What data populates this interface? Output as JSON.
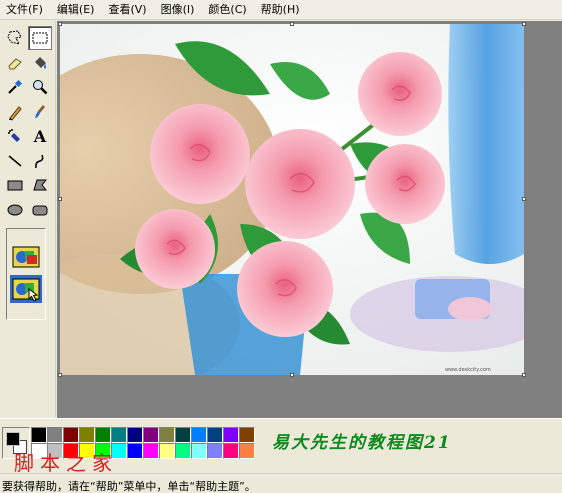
{
  "menu": [
    {
      "label": "文件(F)"
    },
    {
      "label": "编辑(E)"
    },
    {
      "label": "查看(V)"
    },
    {
      "label": "图像(I)"
    },
    {
      "label": "颜色(C)"
    },
    {
      "label": "帮助(H)"
    }
  ],
  "tools": [
    {
      "icon": "free-form-select-icon",
      "label": "free-form-select"
    },
    {
      "icon": "rect-select-icon",
      "label": "select",
      "selected": true
    },
    {
      "icon": "eraser-icon",
      "label": "eraser"
    },
    {
      "icon": "fill-bucket-icon",
      "label": "fill-with-color"
    },
    {
      "icon": "color-picker-icon",
      "label": "pick-color"
    },
    {
      "icon": "magnifier-icon",
      "label": "magnifier"
    },
    {
      "icon": "pencil-icon",
      "label": "pencil"
    },
    {
      "icon": "brush-icon",
      "label": "brush"
    },
    {
      "icon": "airbrush-icon",
      "label": "airbrush"
    },
    {
      "icon": "text-icon",
      "label": "text",
      "glyph": "A"
    },
    {
      "icon": "line-icon",
      "label": "line"
    },
    {
      "icon": "curve-icon",
      "label": "curve"
    },
    {
      "icon": "rectangle-icon",
      "label": "rectangle"
    },
    {
      "icon": "polygon-icon",
      "label": "polygon"
    },
    {
      "icon": "ellipse-icon",
      "label": "ellipse"
    },
    {
      "icon": "rounded-rectangle-icon",
      "label": "rounded-rectangle"
    }
  ],
  "tool_options": [
    {
      "icon": "opaque-selection-icon"
    },
    {
      "icon": "transparent-selection-icon",
      "selected": true
    }
  ],
  "palette": {
    "foreground": "#000000",
    "background": "#ffffff",
    "colors": [
      "#000000",
      "#808080",
      "#800000",
      "#808000",
      "#008000",
      "#008080",
      "#000080",
      "#800080",
      "#808040",
      "#004040",
      "#0080ff",
      "#004080",
      "#8000ff",
      "#804000",
      "#ffffff",
      "#c0c0c0",
      "#ff0000",
      "#ffff00",
      "#00ff00",
      "#00ffff",
      "#0000ff",
      "#ff00ff",
      "#ffff80",
      "#00ff80",
      "#80ffff",
      "#8080ff",
      "#ff0080",
      "#ff8040"
    ]
  },
  "brand_text": "易大先生的教程图21",
  "watermark_text": "脚本之家",
  "status_text": "要获得帮助，请在“帮助”菜单中，单击“帮助主题”。",
  "canvas": {
    "image_description_icon": "roses-photo-icon",
    "photo_caption": "www.deskcity.com"
  }
}
